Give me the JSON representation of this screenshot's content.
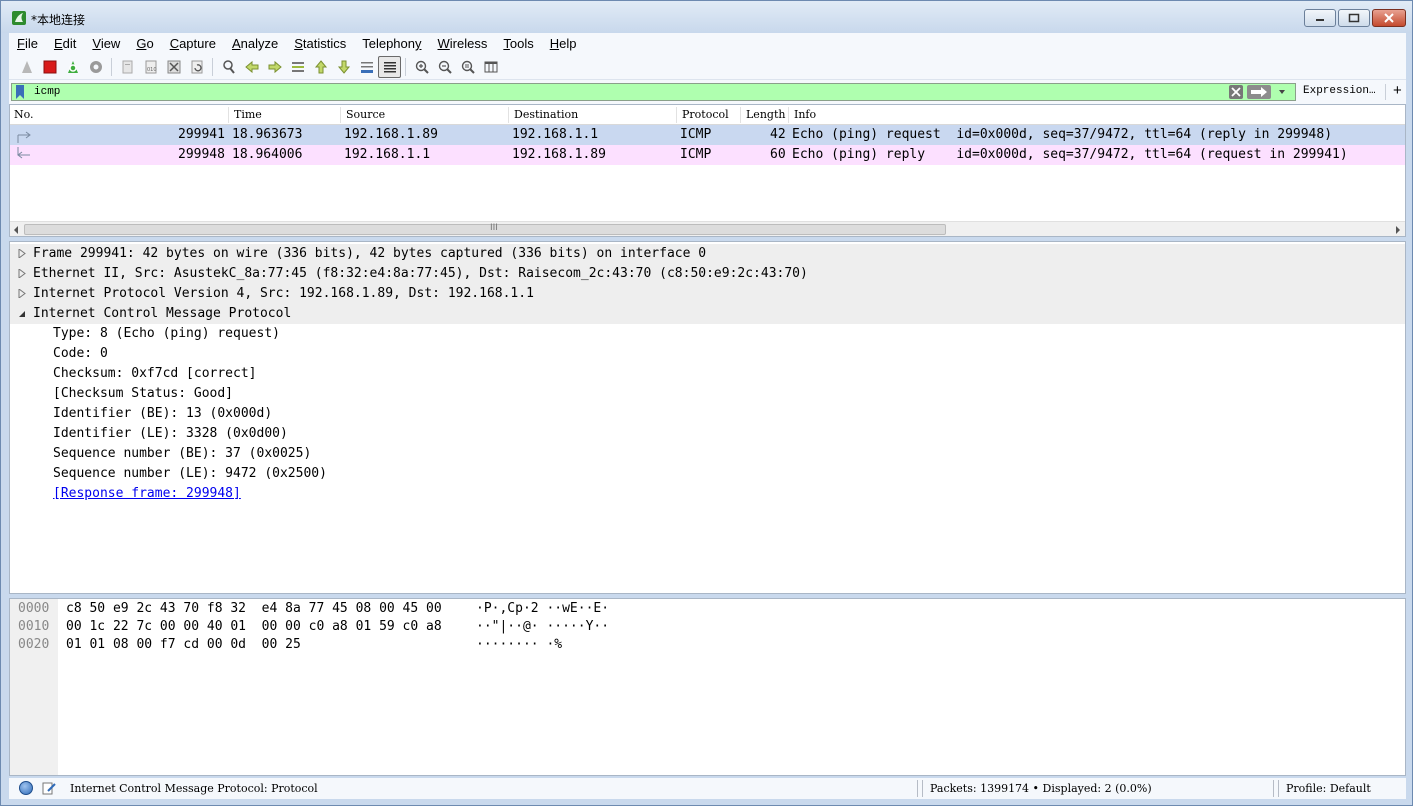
{
  "window": {
    "title": "*本地连接"
  },
  "menu": [
    {
      "key": "F",
      "rest": "ile"
    },
    {
      "key": "E",
      "rest": "dit"
    },
    {
      "key": "V",
      "rest": "iew"
    },
    {
      "key": "G",
      "rest": "o"
    },
    {
      "key": "C",
      "rest": "apture"
    },
    {
      "key": "A",
      "rest": "nalyze"
    },
    {
      "key": "S",
      "rest": "tatistics"
    },
    {
      "key": "",
      "rest": "Telephon",
      "key2": "y"
    },
    {
      "key": "W",
      "rest": "ireless"
    },
    {
      "key": "T",
      "rest": "ools"
    },
    {
      "key": "H",
      "rest": "elp"
    }
  ],
  "filter": {
    "value": "icmp",
    "expression_label": "Expression…",
    "plus_label": "+"
  },
  "packet_list": {
    "columns": [
      "No.",
      "Time",
      "Source",
      "Destination",
      "Protocol",
      "Length",
      "Info"
    ],
    "rows": [
      {
        "no": "299941",
        "time": "18.963673",
        "source": "192.168.1.89",
        "destination": "192.168.1.1",
        "protocol": "ICMP",
        "length": "42",
        "info": "Echo (ping) request  id=0x000d, seq=37/9472, ttl=64 (reply in 299948)"
      },
      {
        "no": "299948",
        "time": "18.964006",
        "source": "192.168.1.1",
        "destination": "192.168.1.89",
        "protocol": "ICMP",
        "length": "60",
        "info": "Echo (ping) reply    id=0x000d, seq=37/9472, ttl=64 (request in 299941)"
      }
    ],
    "scroll_grip": "III"
  },
  "details": {
    "top_level": [
      {
        "text": "Frame 299941: 42 bytes on wire (336 bits), 42 bytes captured (336 bits) on interface 0",
        "expanded": false
      },
      {
        "text": "Ethernet II, Src: AsustekC_8a:77:45 (f8:32:e4:8a:77:45), Dst: Raisecom_2c:43:70 (c8:50:e9:2c:43:70)",
        "expanded": false
      },
      {
        "text": "Internet Protocol Version 4, Src: 192.168.1.89, Dst: 192.168.1.1",
        "expanded": false
      },
      {
        "text": "Internet Control Message Protocol",
        "expanded": true
      }
    ],
    "icmp_fields": [
      "Type: 8 (Echo (ping) request)",
      "Code: 0",
      "Checksum: 0xf7cd [correct]",
      "[Checksum Status: Good]",
      "Identifier (BE): 13 (0x000d)",
      "Identifier (LE): 3328 (0x0d00)",
      "Sequence number (BE): 37 (0x0025)",
      "Sequence number (LE): 9472 (0x2500)"
    ],
    "response_link": "[Response frame: 299948]"
  },
  "bytes": [
    {
      "offset": "0000",
      "hex": "c8 50 e9 2c 43 70 f8 32  e4 8a 77 45 08 00 45 00",
      "ascii": "·P·,Cp·2 ··wE··E·"
    },
    {
      "offset": "0010",
      "hex": "00 1c 22 7c 00 00 40 01  00 00 c0 a8 01 59 c0 a8",
      "ascii": "··\"|··@· ·····Y··"
    },
    {
      "offset": "0020",
      "hex": "01 01 08 00 f7 cd 00 0d  00 25",
      "ascii": "········ ·%"
    }
  ],
  "status": {
    "message": "Internet Control Message Protocol: Protocol",
    "packets": "Packets: 1399174 • Displayed: 2 (0.0%)",
    "profile": "Profile: Default"
  },
  "colors": {
    "row_selected": "#c9d8f0",
    "row_icmp": "#fce0ff",
    "filter_ok": "#afffaf"
  },
  "icons": [
    "start-capture-icon",
    "stop-capture-icon",
    "restart-capture-icon",
    "capture-options-icon",
    "open-file-icon",
    "save-file-icon",
    "close-file-icon",
    "reload-icon",
    "find-packet-icon",
    "go-back-icon",
    "go-forward-icon",
    "go-to-packet-icon",
    "go-first-icon",
    "go-last-icon",
    "autoscroll-icon",
    "colorize-icon",
    "zoom-in-icon",
    "zoom-out-icon",
    "normal-size-icon",
    "resize-columns-icon"
  ]
}
